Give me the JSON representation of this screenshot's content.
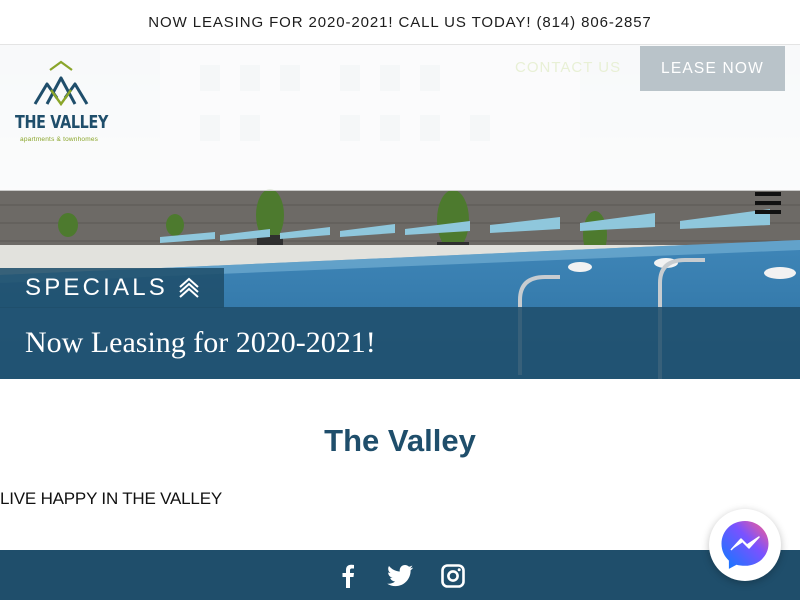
{
  "announcement": {
    "text": "NOW LEASING FOR 2020-2021! CALL US TODAY! (814) 806-2857"
  },
  "logo": {
    "name": "THE VALLEY",
    "subtitle": "apartments & townhomes",
    "icon": "mountain-logo-icon"
  },
  "nav": {
    "contact_label": "CONTACT US",
    "lease_label": "LEASE NOW",
    "menu_icon": "hamburger-menu-icon"
  },
  "specials": {
    "tab_label": "SPECIALS",
    "tab_icon": "double-chevron-up-icon",
    "headline": "Now Leasing for 2020-2021!"
  },
  "content": {
    "title": "The Valley",
    "tagline": "LIVE HAPPY IN THE VALLEY"
  },
  "footer": {
    "social": [
      "facebook-icon",
      "twitter-icon",
      "instagram-icon"
    ]
  },
  "chat": {
    "icon": "messenger-icon"
  },
  "colors": {
    "brand": "#1f4e6b",
    "accent": "#8aa52a",
    "button": "#b9c3c9"
  }
}
